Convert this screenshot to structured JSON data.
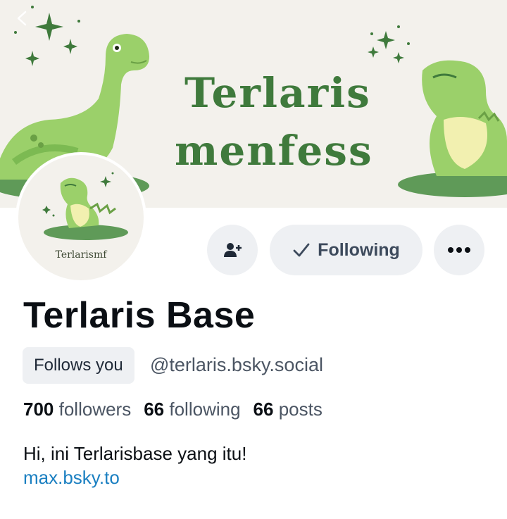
{
  "banner": {
    "title_line1": "Terlaris",
    "title_line2": "menfess",
    "bg_color": "#f3f1ec",
    "accent": "#3f7a3c"
  },
  "avatar": {
    "label": "Terlarismf"
  },
  "actions": {
    "add_icon": "person-add-icon",
    "following_label": "Following",
    "check_icon": "check-icon",
    "more_icon": "ellipsis-icon"
  },
  "profile": {
    "display_name": "Terlaris Base",
    "follows_you": "Follows you",
    "handle": "@terlaris.bsky.social",
    "followers_count": "700",
    "followers_label": "followers",
    "following_count": "66",
    "following_label": "following",
    "posts_count": "66",
    "posts_label": "posts",
    "bio": "Hi, ini Terlarisbase yang itu!",
    "link": "max.bsky.to",
    "link_color": "#1a7fc1"
  }
}
